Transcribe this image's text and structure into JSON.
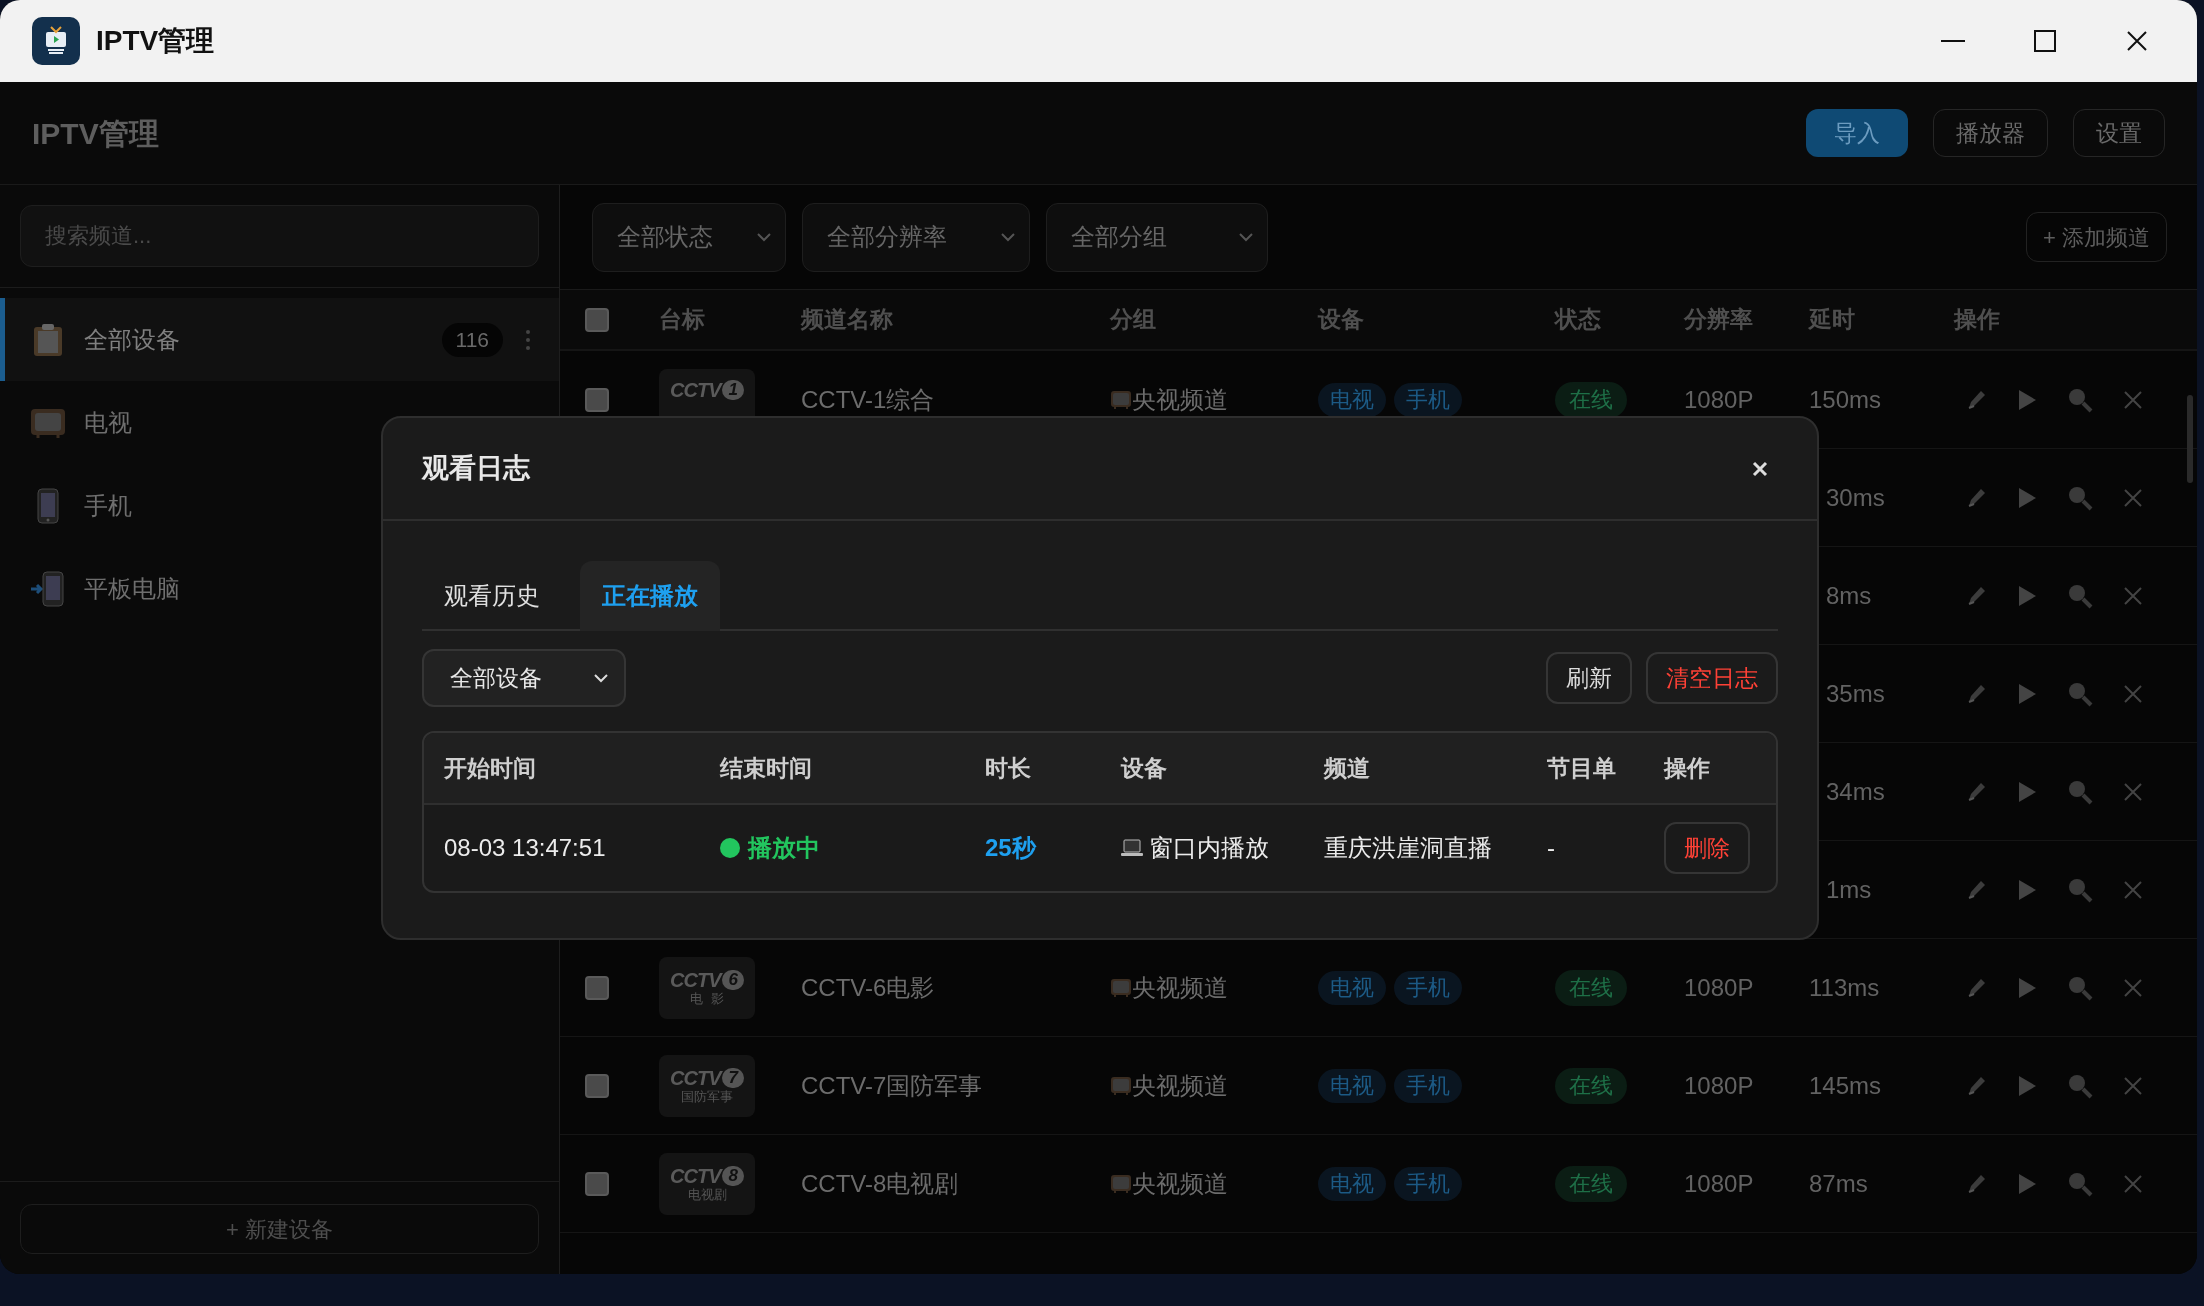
{
  "window": {
    "title": "IPTV管理"
  },
  "header": {
    "title": "IPTV管理",
    "buttons": [
      {
        "label": "导入",
        "kind": "primary"
      },
      {
        "label": "播放器",
        "kind": "outline"
      },
      {
        "label": "设置",
        "kind": "outline"
      }
    ]
  },
  "sidebar": {
    "search": {
      "placeholder": "搜索频道..."
    },
    "items": [
      {
        "label": "全部设备",
        "kind": "all",
        "count": "116",
        "selected": true
      },
      {
        "label": "电视",
        "kind": "tv",
        "selected": false
      },
      {
        "label": "手机",
        "kind": "phone",
        "selected": false
      },
      {
        "label": "平板电脑",
        "kind": "tablet",
        "selected": false
      }
    ],
    "new_button": "+ 新建设备"
  },
  "filters": [
    {
      "label": "全部状态"
    },
    {
      "label": "全部分辨率"
    },
    {
      "label": "全部分组"
    }
  ],
  "add_button": "+ 添加频道",
  "table": {
    "select_all_checked": false,
    "columns": [
      "台标",
      "频道名称",
      "分组",
      "设备",
      "状态",
      "分辨率",
      "延时",
      "操作"
    ],
    "rows": [
      {
        "checked": false,
        "logo": {
          "mark": "CCTV",
          "number": "1"
        },
        "name": "CCTV-1综合",
        "group": "央视频道",
        "devices": [
          "电视",
          "手机"
        ],
        "status": {
          "label": "在线",
          "kind": "online"
        },
        "resolution": "1080P",
        "latency": "150ms"
      }
    ],
    "rows_under_dialog": [
      {
        "latency": "30ms"
      },
      {
        "latency": "8ms"
      },
      {
        "latency": "35ms"
      },
      {
        "latency": "34ms"
      },
      {
        "latency": "1ms"
      }
    ],
    "rows_after_dialog": [
      {
        "checked": false,
        "logo": {
          "mark": "CCTV",
          "number": "6",
          "caption": "电  影"
        },
        "name": "CCTV-6电影",
        "group": "央视频道",
        "devices": [
          "电视",
          "手机"
        ],
        "status": {
          "label": "在线",
          "kind": "online"
        },
        "resolution": "1080P",
        "latency": "113ms"
      },
      {
        "checked": false,
        "logo": {
          "mark": "CCTV",
          "number": "7",
          "caption": "国防军事"
        },
        "name": "CCTV-7国防军事",
        "group": "央视频道",
        "devices": [
          "电视",
          "手机"
        ],
        "status": {
          "label": "在线",
          "kind": "online"
        },
        "resolution": "1080P",
        "latency": "145ms"
      },
      {
        "checked": false,
        "logo": {
          "mark": "CCTV",
          "number": "8",
          "caption": "电视剧"
        },
        "name": "CCTV-8电视剧",
        "group": "央视频道",
        "devices": [
          "电视",
          "手机"
        ],
        "status": {
          "label": "在线",
          "kind": "online"
        },
        "resolution": "1080P",
        "latency": "87ms"
      }
    ]
  },
  "dialog": {
    "title": "观看日志",
    "tabs": [
      {
        "label": "观看历史",
        "selected": false
      },
      {
        "label": "正在播放",
        "selected": true
      }
    ],
    "device_filter": "全部设备",
    "buttons": [
      {
        "label": "刷新",
        "kind": "default"
      },
      {
        "label": "清空日志",
        "kind": "danger"
      }
    ],
    "columns": [
      "开始时间",
      "结束时间",
      "时长",
      "设备",
      "频道",
      "节目单",
      "操作"
    ],
    "rows": [
      {
        "start": "08-03 13:47:51",
        "end": {
          "label": "播放中",
          "kind": "playing"
        },
        "duration": "25秒",
        "device": {
          "label": "窗口内播放",
          "kind": "laptop"
        },
        "channel": "重庆洪崖洞直播",
        "program": "-",
        "action": "删除"
      }
    ]
  }
}
